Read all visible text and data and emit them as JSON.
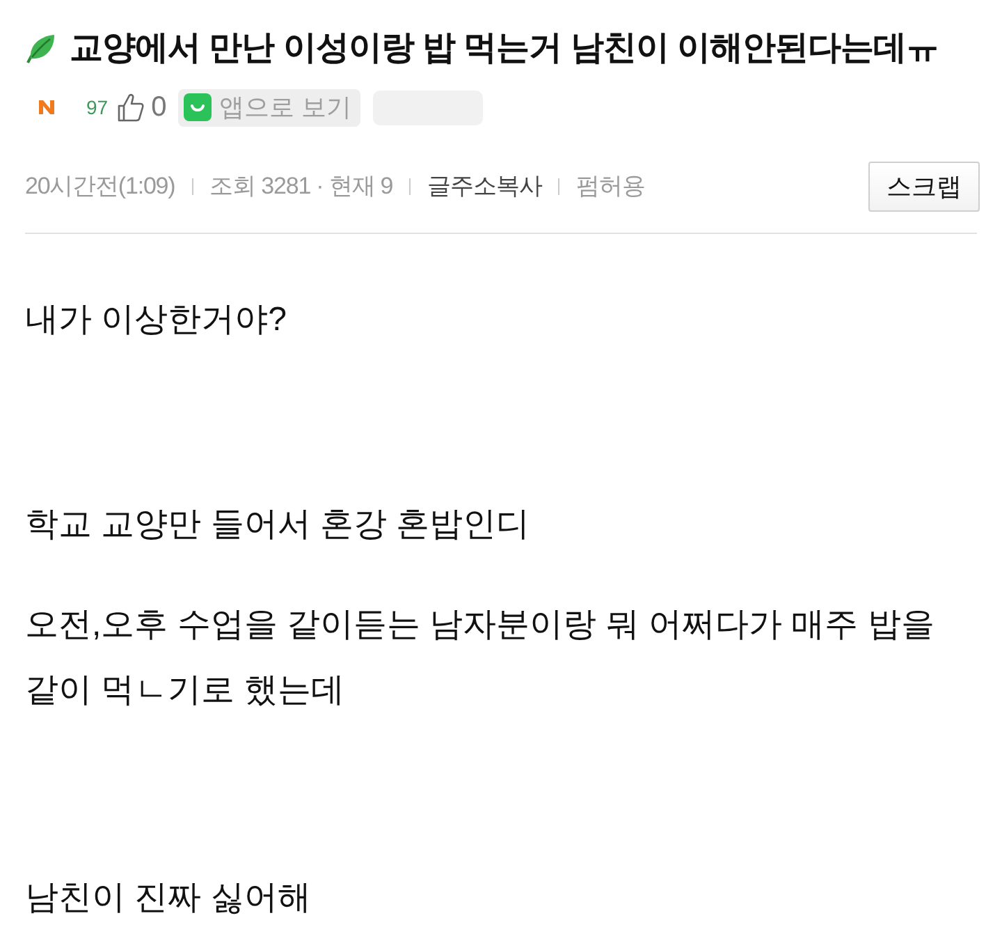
{
  "post": {
    "title": "교양에서 만난 이성이랑 밥 먹는거 남친이 이해안된다는데ㅠ"
  },
  "stats": {
    "points": "97",
    "likes": "0",
    "app_button": "앱으로 보기"
  },
  "meta": {
    "time": "20시간전(1:09)",
    "views": "조회 3281 · 현재 9",
    "copy_link": "글주소복사",
    "permission": "펌허용",
    "scrap_button": "스크랩"
  },
  "body": [
    "내가 이상한거야?",
    "학교 교양만 들어서 혼강 혼밥인디",
    "오전,오후 수업을 같이듣는 남자분이랑 뭐 어쩌다가 매주 밥을 같이 먹ㄴ기로 했는데",
    "남친이 진짜 싫어해"
  ]
}
